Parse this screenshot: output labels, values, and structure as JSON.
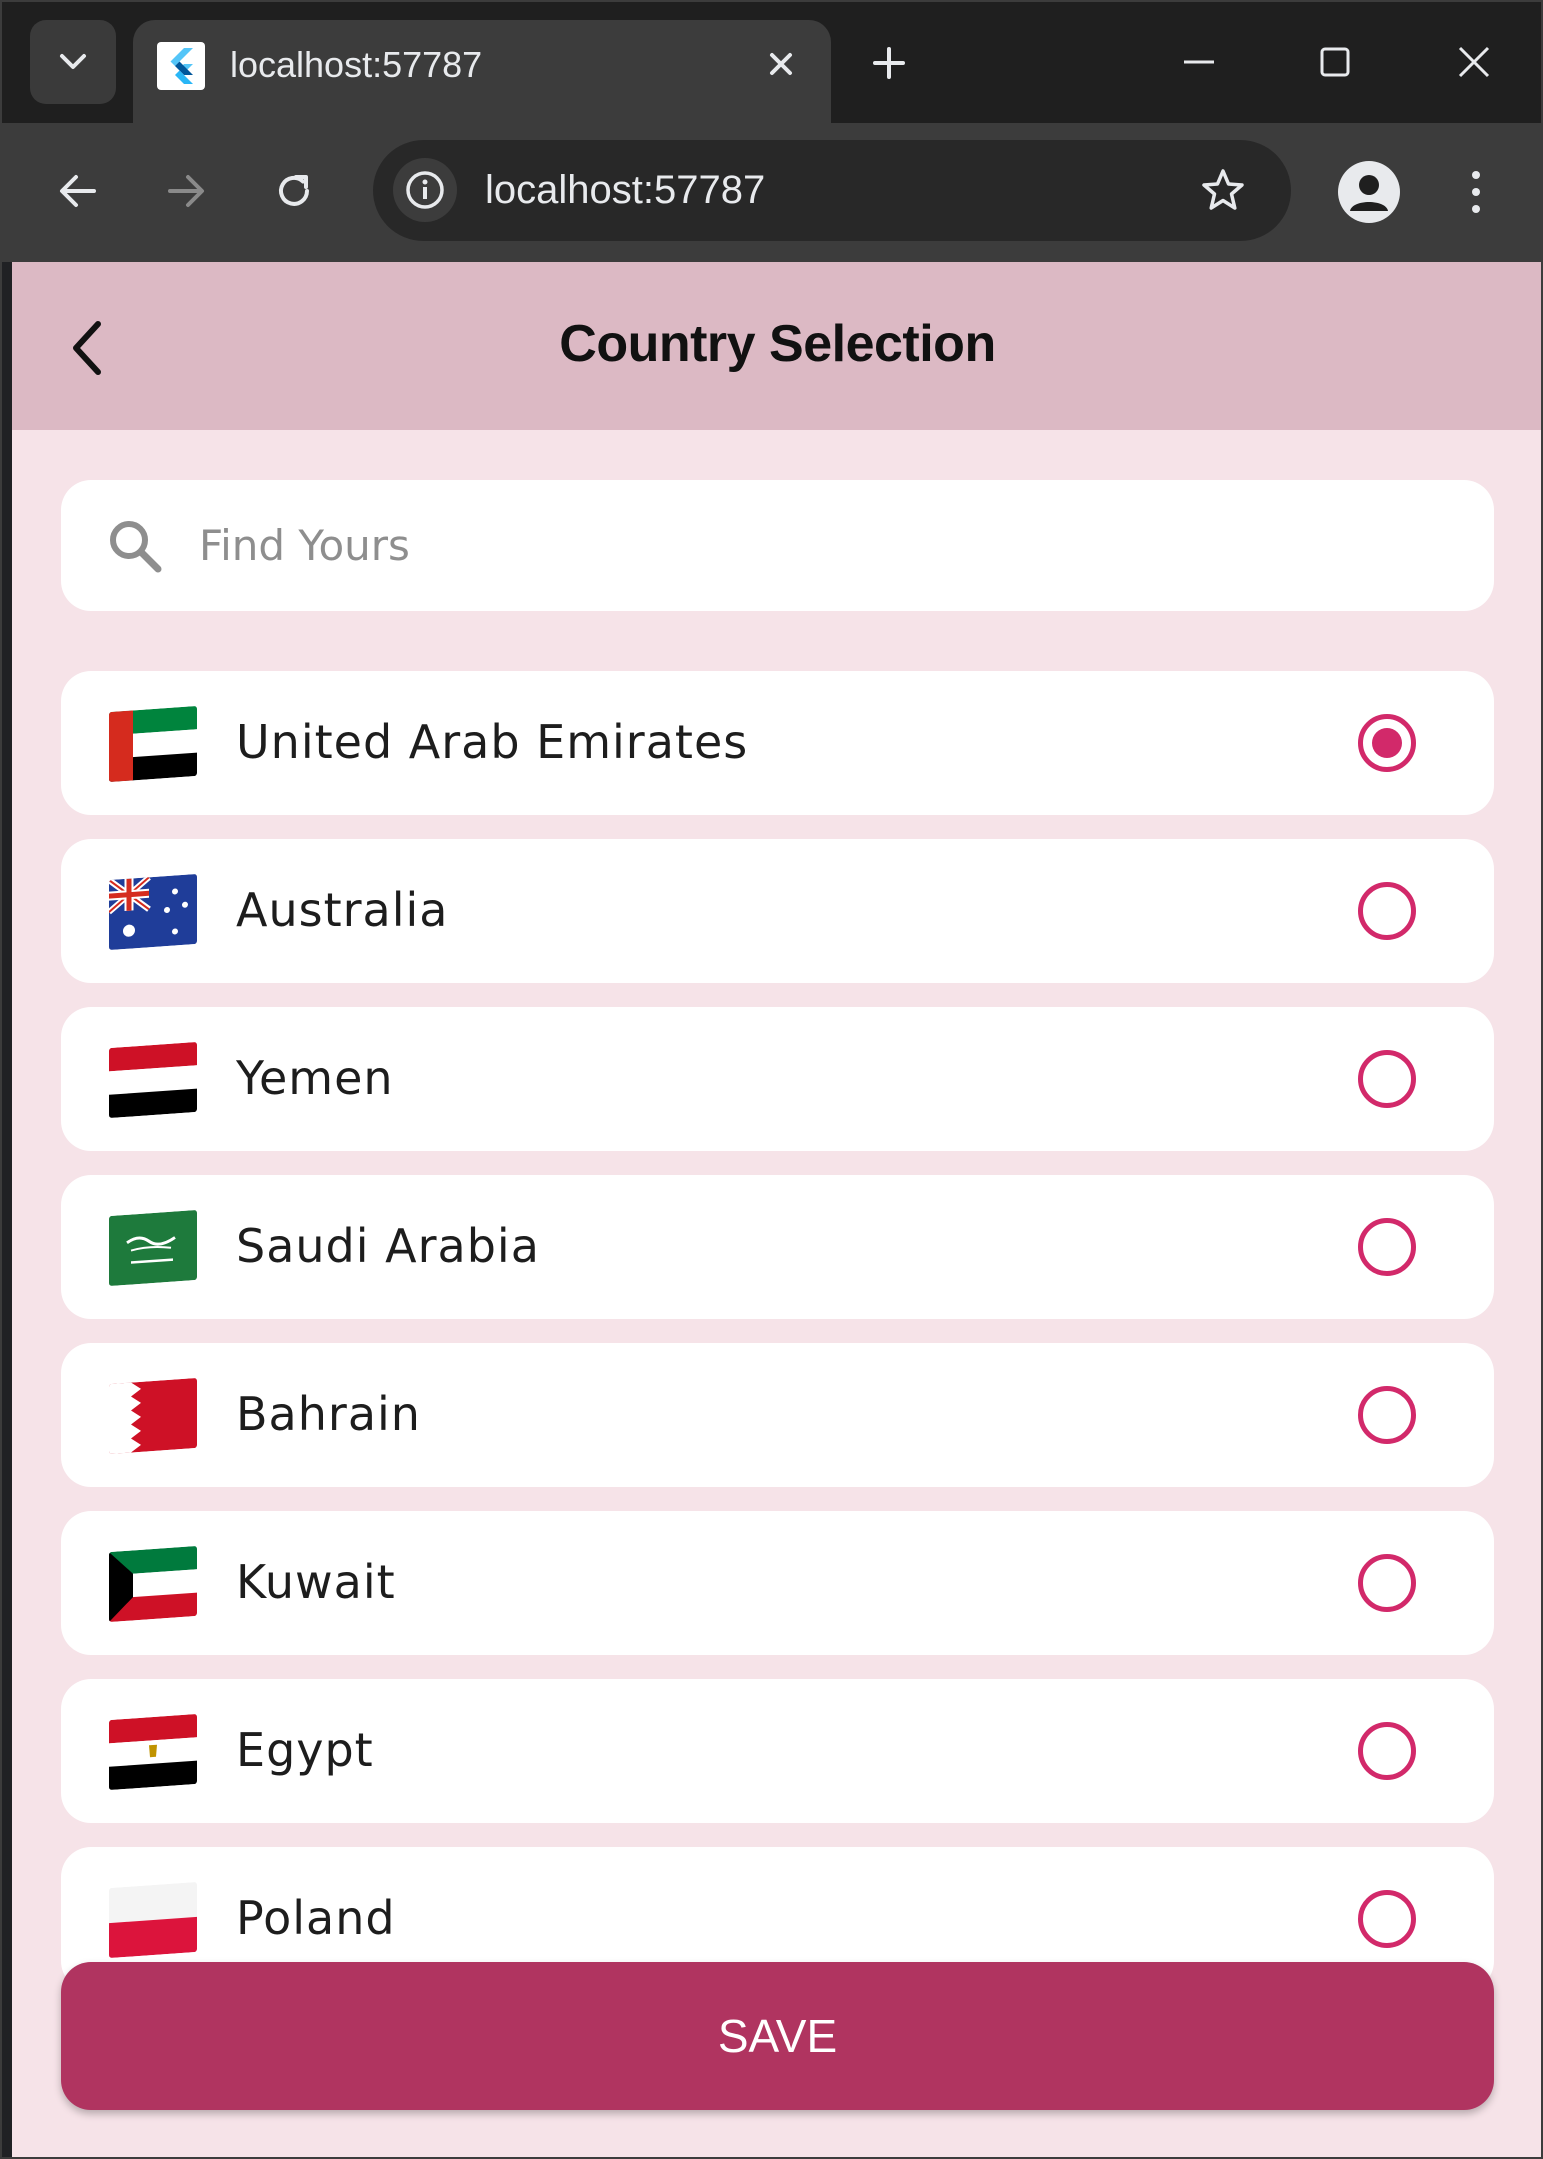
{
  "browser": {
    "tab_title": "localhost:57787",
    "url": "localhost:57787",
    "icons": {
      "tab_menu": "chevron-down-icon",
      "favicon": "flutter-icon",
      "tab_close": "close-icon",
      "new_tab": "plus-icon",
      "minimize": "minimize-icon",
      "maximize": "maximize-icon",
      "close_window": "close-icon",
      "back": "arrow-left-icon",
      "forward": "arrow-right-icon",
      "reload": "reload-icon",
      "site_info": "info-icon",
      "bookmark": "star-icon",
      "profile": "profile-icon",
      "menu": "kebab-icon"
    }
  },
  "app": {
    "title": "Country Selection",
    "search": {
      "placeholder": "Find Yours",
      "value": ""
    },
    "countries": [
      {
        "name": "United Arab Emirates",
        "selected": true
      },
      {
        "name": "Australia",
        "selected": false
      },
      {
        "name": "Yemen",
        "selected": false
      },
      {
        "name": "Saudi Arabia",
        "selected": false
      },
      {
        "name": "Bahrain",
        "selected": false
      },
      {
        "name": "Kuwait",
        "selected": false
      },
      {
        "name": "Egypt",
        "selected": false
      },
      {
        "name": "Poland",
        "selected": false
      }
    ],
    "save_label": "SAVE",
    "colors": {
      "appbar": "#dcb9c4",
      "background": "#f6e3e8",
      "accent": "#d2296a",
      "save_button": "#b03460"
    }
  }
}
